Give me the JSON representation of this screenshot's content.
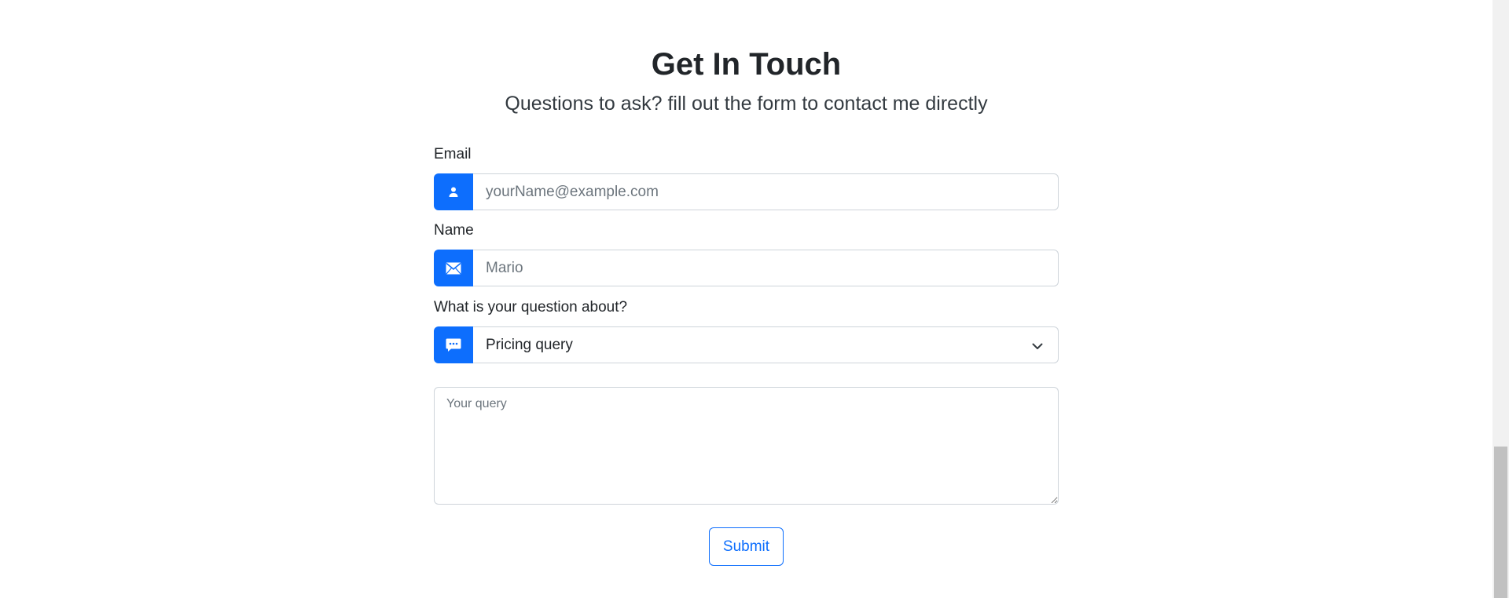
{
  "header": {
    "title": "Get In Touch",
    "subtitle": "Questions to ask? fill out the form to contact me directly"
  },
  "form": {
    "email": {
      "label": "Email",
      "placeholder": "yourName@example.com",
      "value": "",
      "icon": "person-icon"
    },
    "name": {
      "label": "Name",
      "placeholder": "Mario",
      "value": "",
      "icon": "envelope-icon"
    },
    "topic": {
      "label": "What is your question about?",
      "selected": "Pricing query",
      "icon": "chat-dots-icon"
    },
    "query": {
      "placeholder": "Your query",
      "value": ""
    },
    "submit_label": "Submit"
  },
  "colors": {
    "accent": "#0d6efd",
    "border": "#ced4da",
    "text": "#212529",
    "placeholder": "#6c757d"
  }
}
